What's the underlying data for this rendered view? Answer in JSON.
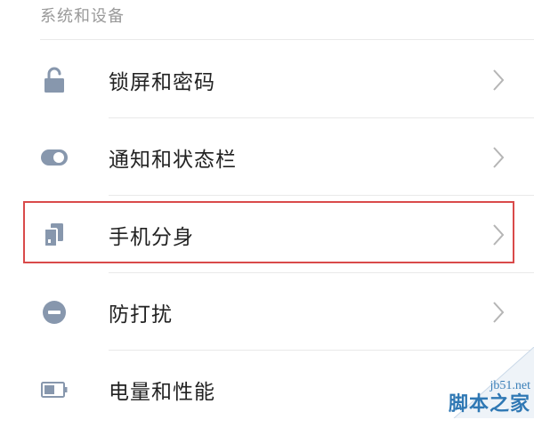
{
  "section": {
    "title": "系统和设备"
  },
  "items": [
    {
      "label": "锁屏和密码",
      "icon": "lock-icon"
    },
    {
      "label": "通知和状态栏",
      "icon": "toggle-icon"
    },
    {
      "label": "手机分身",
      "icon": "phone-clone-icon",
      "highlighted": true
    },
    {
      "label": "防打扰",
      "icon": "do-not-disturb-icon"
    },
    {
      "label": "电量和性能",
      "icon": "battery-icon"
    }
  ],
  "colors": {
    "icon": "#8797ad",
    "chevron": "#b5b5b5",
    "highlight": "#d94a4a"
  },
  "watermark": {
    "url": "jb51.net",
    "site": "脚本之家"
  }
}
